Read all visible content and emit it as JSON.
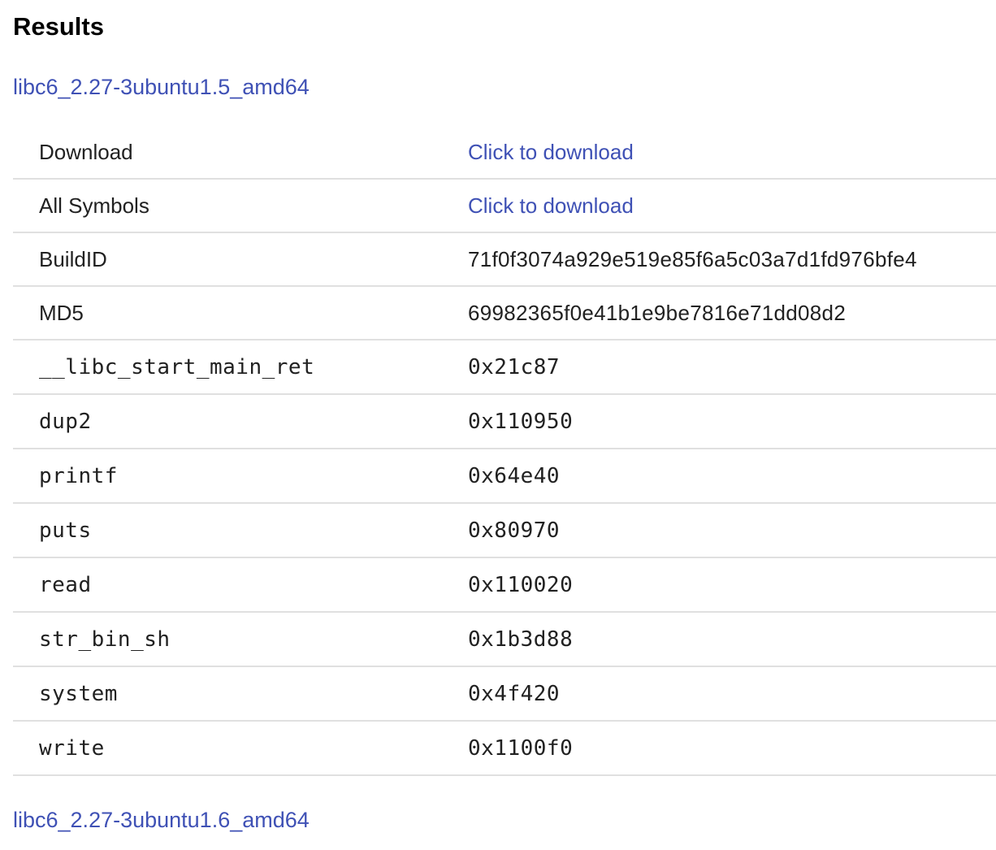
{
  "heading": "Results",
  "results": [
    {
      "name": "libc6_2.27-3ubuntu1.5_amd64",
      "download_label": "Download",
      "download_link": "Click to download",
      "all_symbols_label": "All Symbols",
      "all_symbols_link": "Click to download",
      "buildid_label": "BuildID",
      "buildid": "71f0f3074a929e519e85f6a5c03a7d1fd976bfe4",
      "md5_label": "MD5",
      "md5": "69982365f0e41b1e9be7816e71dd08d2",
      "symbols": [
        {
          "name": "__libc_start_main_ret",
          "offset": "0x21c87"
        },
        {
          "name": "dup2",
          "offset": "0x110950"
        },
        {
          "name": "printf",
          "offset": "0x64e40"
        },
        {
          "name": "puts",
          "offset": "0x80970"
        },
        {
          "name": "read",
          "offset": "0x110020"
        },
        {
          "name": "str_bin_sh",
          "offset": "0x1b3d88"
        },
        {
          "name": "system",
          "offset": "0x4f420"
        },
        {
          "name": "write",
          "offset": "0x1100f0"
        }
      ]
    },
    {
      "name": "libc6_2.27-3ubuntu1.6_amd64"
    }
  ],
  "colors": {
    "link": "#3f51b5",
    "divider": "#e0e0e0",
    "text": "#212121"
  }
}
